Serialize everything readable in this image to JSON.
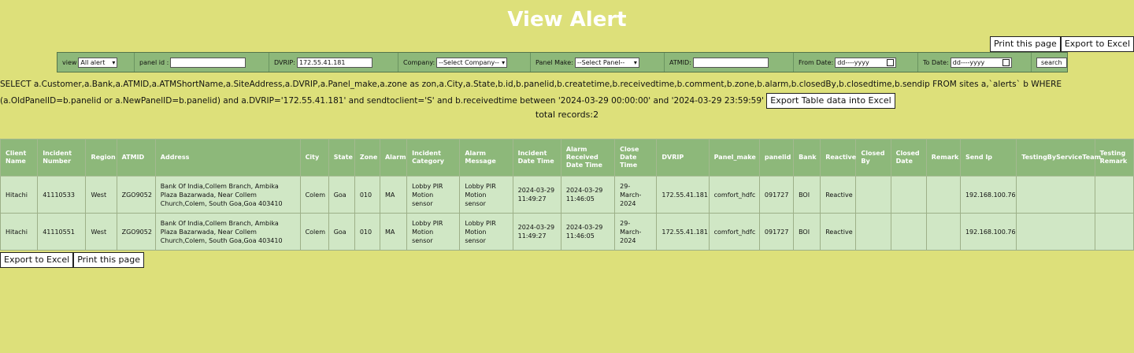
{
  "page": {
    "title": "View Alert"
  },
  "top_actions": {
    "print_label": "Print this page",
    "export_label": "Export to Excel"
  },
  "filters": {
    "view_label": "view",
    "view_value": "All alert",
    "panel_id_label": "panel id :",
    "panel_id_value": "",
    "dvrip_label": "DVRIP:",
    "dvrip_value": "172.55.41.181",
    "company_label": "Company:",
    "company_value": "--Select Company--",
    "panel_make_label": "Panel Make:",
    "panel_make_value": "--Select Panel--",
    "atmid_label": "ATMID:",
    "atmid_value": "",
    "from_date_label": "From Date:",
    "from_date_placeholder": "dd----yyyy",
    "to_date_label": "To Date:",
    "to_date_placeholder": "dd----yyyy",
    "search_label": "search"
  },
  "query": {
    "text": "SELECT a.Customer,a.Bank,a.ATMID,a.ATMShortName,a.SiteAddress,a.DVRIP,a.Panel_make,a.zone as zon,a.City,a.State,b.id,b.panelid,b.createtime,b.receivedtime,b.comment,b.zone,b.alarm,b.closedBy,b.closedtime,b.sendip FROM sites a,`alerts` b WHERE (a.OldPanelID=b.panelid or a.NewPanelID=b.panelid) and a.DVRIP='172.55.41.181' and sendtoclient='S' and b.receivedtime between '2024-03-29 00:00:00' and '2024-03-29 23:59:59'",
    "export_table_label": "Export Table data into Excel"
  },
  "total_records": "total records:2",
  "table": {
    "headers": [
      "Client Name",
      "Incident Number",
      "Region",
      "ATMID",
      "Address",
      "City",
      "State",
      "Zone",
      "Alarm",
      "Incident Category",
      "Alarm Message",
      "Incident Date Time",
      "Alarm Received Date Time",
      "Close Date Time",
      "DVRIP",
      "Panel_make",
      "panelid",
      "Bank",
      "Reactive",
      "Closed By",
      "Closed Date",
      "Remark",
      "Send Ip",
      "TestingByServiceTeam",
      "Testing Remark"
    ],
    "rows": [
      [
        "Hitachi",
        "41110533",
        "West",
        "ZGO9052",
        "Bank Of India,Collem Branch, Ambika Plaza Bazarwada, Near Collem Church,Colem, South Goa,Goa 403410",
        "Colem",
        "Goa",
        "010",
        "MA",
        "Lobby PIR Motion sensor",
        "Lobby PIR Motion sensor",
        "2024-03-29 11:49:27",
        "2024-03-29 11:46:05",
        "29-March-2024",
        "172.55.41.181",
        "comfort_hdfc",
        "091727",
        "BOI",
        "Reactive",
        "",
        "",
        "",
        "192.168.100.76",
        "",
        ""
      ],
      [
        "Hitachi",
        "41110551",
        "West",
        "ZGO9052",
        "Bank Of India,Collem Branch, Ambika Plaza Bazarwada, Near Collem Church,Colem, South Goa,Goa 403410",
        "Colem",
        "Goa",
        "010",
        "MA",
        "Lobby PIR Motion sensor",
        "Lobby PIR Motion sensor",
        "2024-03-29 11:49:27",
        "2024-03-29 11:46:05",
        "29-March-2024",
        "172.55.41.181",
        "comfort_hdfc",
        "091727",
        "BOI",
        "Reactive",
        "",
        "",
        "",
        "192.168.100.76",
        "",
        ""
      ]
    ]
  },
  "bottom_actions": {
    "export_label": "Export to Excel",
    "print_label": "Print this page"
  }
}
